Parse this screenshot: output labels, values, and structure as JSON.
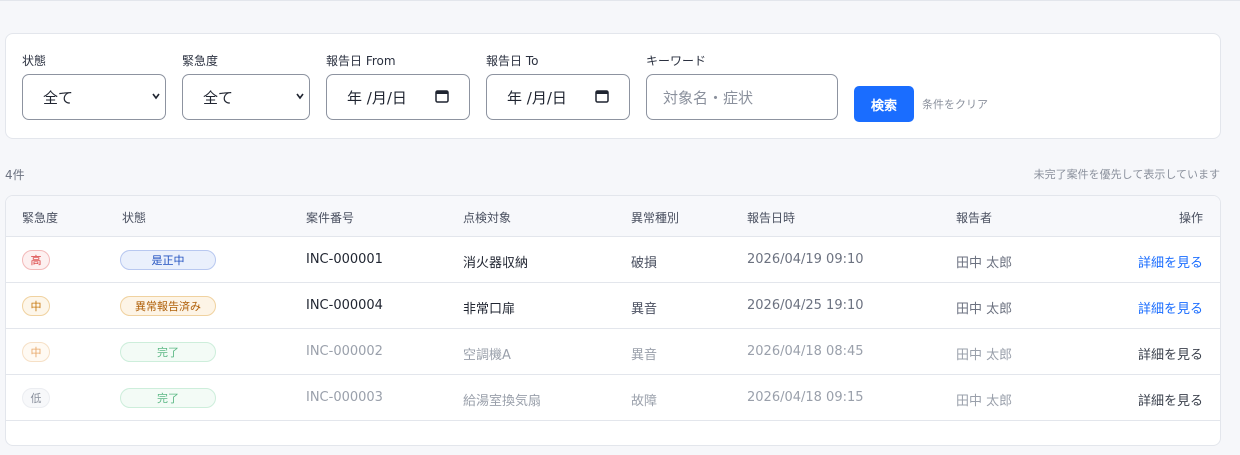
{
  "filters": {
    "status": {
      "label": "状態",
      "value": "全て"
    },
    "urgency": {
      "label": "緊急度",
      "value": "全て"
    },
    "date_from": {
      "label": "報告日 From",
      "value": "年 /月/日"
    },
    "date_to": {
      "label": "報告日 To",
      "value": "年 /月/日"
    },
    "keyword": {
      "label": "キーワード",
      "placeholder": "対象名・症状"
    },
    "search_label": "検索",
    "clear_label": "条件をクリア"
  },
  "summary": {
    "count": "4件",
    "note": "未完了案件を優先して表示しています"
  },
  "table": {
    "columns": [
      "緊急度",
      "状態",
      "案件番号",
      "点検対象",
      "異常種別",
      "報告日時",
      "報告者",
      "操作"
    ],
    "rows": [
      {
        "priority": "高",
        "status": "是正中",
        "id": "INC-000001",
        "target": "消火器収納",
        "type": "破損",
        "datetime": "2026/04/19 09:10",
        "reporter": "田中 太郎",
        "action": "詳細を見る"
      },
      {
        "priority": "中",
        "status": "異常報告済み",
        "id": "INC-000004",
        "target": "非常口扉",
        "type": "異音",
        "datetime": "2026/04/25 19:10",
        "reporter": "田中 太郎",
        "action": "詳細を見る"
      },
      {
        "priority": "中",
        "status": "完了",
        "id": "INC-000002",
        "target": "空調機A",
        "type": "異音",
        "datetime": "2026/04/18 08:45",
        "reporter": "田中 太郎",
        "action": "詳細を見る"
      },
      {
        "priority": "低",
        "status": "完了",
        "id": "INC-000003",
        "target": "給湯室換気扇",
        "type": "故障",
        "datetime": "2026/04/18 09:15",
        "reporter": "田中 太郎",
        "action": "詳細を見る"
      }
    ]
  },
  "colors": {
    "accent": "#1a6dff",
    "high": "#d93b3b",
    "medium": "#c77a12",
    "in_progress": "#1f4fbf",
    "reported": "#b0600a",
    "done": "#5cb885"
  }
}
